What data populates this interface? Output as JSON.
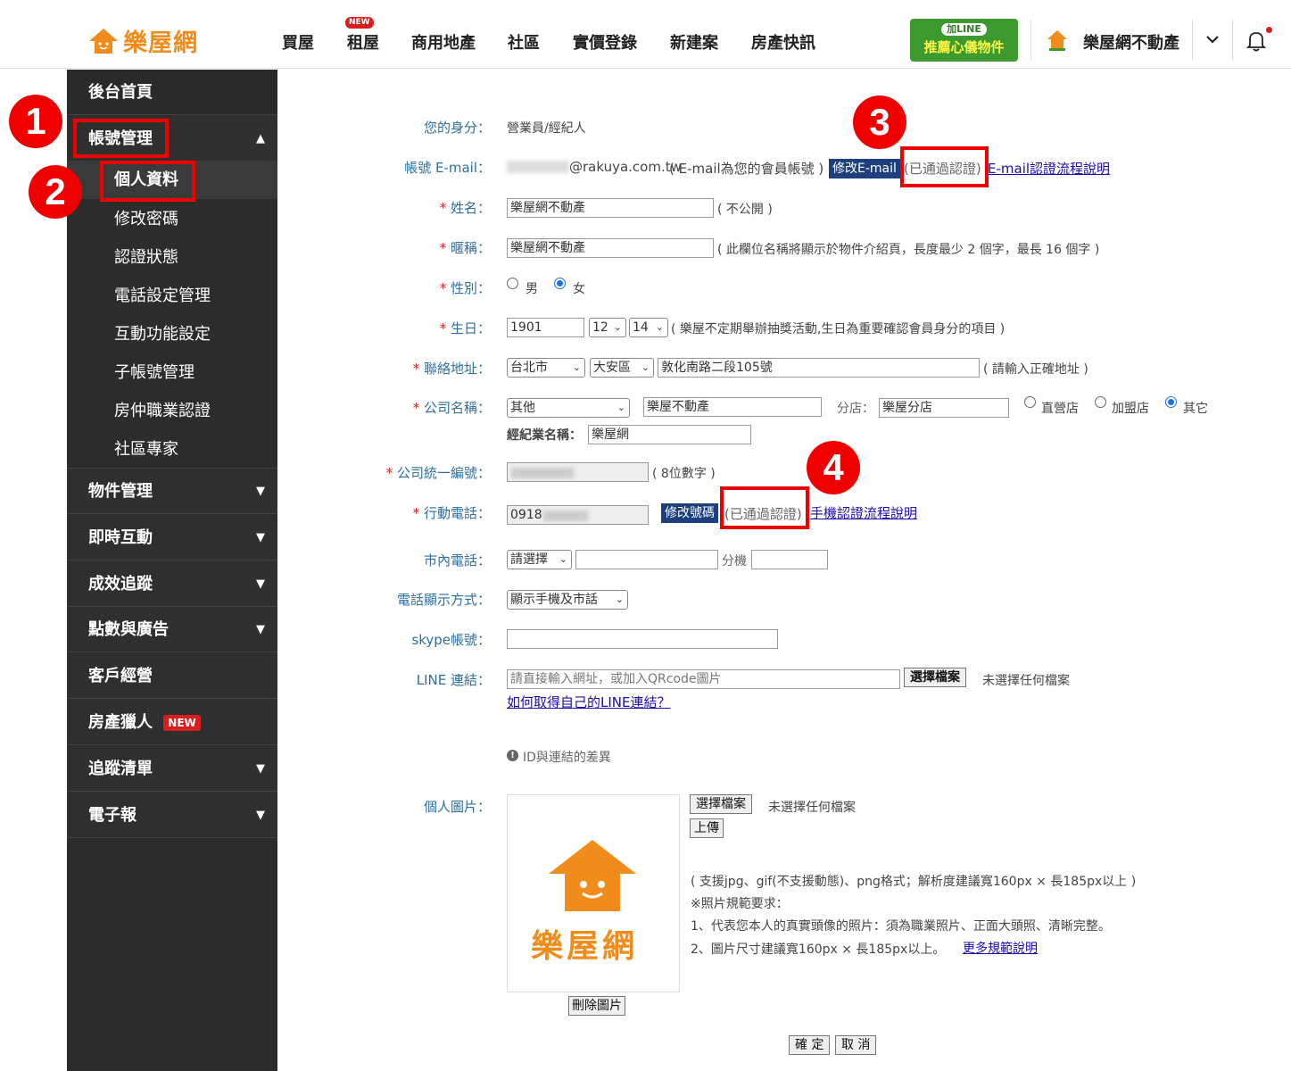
{
  "header": {
    "logo": "樂屋網",
    "nav": [
      "買屋",
      "租屋",
      "商用地產",
      "社區",
      "實價登錄",
      "新建案",
      "房產快訊"
    ],
    "new_badge": "NEW",
    "line_top": "加LINE",
    "line_bottom": "推薦心儀物件",
    "user_name": "樂屋網不動產",
    "colors": {
      "brand": "#f08c1b",
      "line_green": "#3c9a2e"
    }
  },
  "sidebar": {
    "home": "後台首頁",
    "account": "帳號管理",
    "sub_items": [
      "個人資料",
      "修改密碼",
      "認證狀態",
      "電話設定管理",
      "互動功能設定",
      "子帳號管理",
      "房仲職業認證",
      "社區專家"
    ],
    "menu": [
      "物件管理",
      "即時互動",
      "成效追蹤",
      "點數與廣告",
      "客戶經營",
      "房產獵人",
      "追蹤清單",
      "電子報"
    ],
    "new_badge": "NEW"
  },
  "steps": [
    "1",
    "2",
    "3",
    "4"
  ],
  "form": {
    "identity_label": "您的身分：",
    "identity_value": "營業員/經紀人",
    "email_label": "帳號 E-mail：",
    "email_value": "@rakuya.com.tw",
    "email_note": "( E-mail為您的會員帳號 )",
    "edit_email_btn": "修改E-mail",
    "verified": "(已通過認證)",
    "email_help_link": "E-mail認證流程說明",
    "name_label": "姓名：",
    "name_value": "樂屋網不動產",
    "name_note": "( 不公開 )",
    "nick_label": "暱稱：",
    "nick_value": "樂屋網不動產",
    "nick_note": "( 此欄位名稱將顯示於物件介紹頁，長度最少 2 個字，最長 16 個字 )",
    "gender_label": "性別：",
    "gender_male": "男",
    "gender_female": "女",
    "birth_label": "生日：",
    "birth_year": "1901",
    "birth_month": "12",
    "birth_day": "14",
    "birth_note": "( 樂屋不定期舉辦抽獎活動,生日為重要確認會員身分的項目 )",
    "addr_label": "聯絡地址：",
    "addr_city": "台北市",
    "addr_district": "大安區",
    "addr_street": "敦化南路二段105號",
    "addr_note": "( 請輸入正確地址 )",
    "company_label": "公司名稱：",
    "company_select": "其他",
    "company_value": "樂屋不動產",
    "branch_label": "分店：",
    "branch_value": "樂屋分店",
    "store_direct": "直營店",
    "store_franchise": "加盟店",
    "store_other": "其它",
    "brokerage_label": "經紀業名稱：",
    "brokerage_value": "樂屋網",
    "taxid_label": "公司統一編號：",
    "taxid_note": "( 8位數字 )",
    "mobile_label": "行動電話：",
    "mobile_value": "0918",
    "edit_phone_btn": "修改號碼",
    "phone_help_link": "手機認證流程說明",
    "landline_label": "市內電話：",
    "landline_select": "請選擇",
    "ext_label": "分機",
    "display_label": "電話顯示方式：",
    "display_value": "顯示手機及市話",
    "skype_label": "skype帳號：",
    "line_label": "LINE 連結：",
    "line_placeholder": "請直接輸入網址，或加入QRcode圖片",
    "choose_file": "選擇檔案",
    "no_file": "未選擇任何檔案",
    "line_help_link": "如何取得自己的LINE連結？",
    "id_diff": "ID與連結的差異",
    "photo_label": "個人圖片：",
    "upload_btn": "上傳",
    "photo_note1": "( 支援jpg、gif(不支援動態)、png格式；解析度建議寬160px × 長185px以上 )",
    "photo_note2": "※照片規範要求：",
    "photo_note3": "1、代表您本人的真實頭像的照片：須為職業照片、正面大頭照、清晰完整。",
    "photo_note4": "2、圖片尺寸建議寬160px × 長185px以上。",
    "more_rules_link": "更多規範說明",
    "delete_photo_btn": "刪除圖片",
    "photo_logo_text": "樂屋網",
    "confirm_btn": "確 定",
    "cancel_btn": "取 消"
  }
}
